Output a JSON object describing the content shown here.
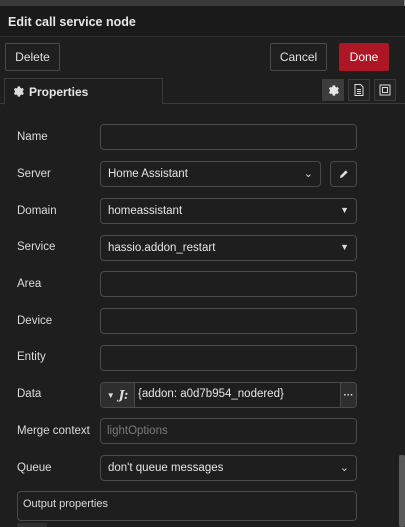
{
  "dialog": {
    "title": "Edit call service node"
  },
  "toolbar": {
    "delete_label": "Delete",
    "cancel_label": "Cancel",
    "done_label": "Done"
  },
  "tabs": {
    "properties_label": "Properties",
    "icons": [
      "gear-icon",
      "description-icon",
      "appearance-icon"
    ]
  },
  "form": {
    "name": {
      "label": "Name",
      "value": ""
    },
    "server": {
      "label": "Server",
      "value": "Home Assistant"
    },
    "domain": {
      "label": "Domain",
      "value": "homeassistant"
    },
    "service": {
      "label": "Service",
      "value": "hassio.addon_restart"
    },
    "area": {
      "label": "Area",
      "value": ""
    },
    "device": {
      "label": "Device",
      "value": ""
    },
    "entity": {
      "label": "Entity",
      "value": ""
    },
    "data": {
      "label": "Data",
      "value": "{addon: a0d7b954_nodered}"
    },
    "merge_context": {
      "label": "Merge context",
      "placeholder": "lightOptions"
    },
    "queue": {
      "label": "Queue",
      "value": "don't queue messages"
    },
    "output_properties": {
      "label": "Output properties"
    }
  },
  "colors": {
    "accent": "#ad1625",
    "background": "#1e1e1e"
  }
}
